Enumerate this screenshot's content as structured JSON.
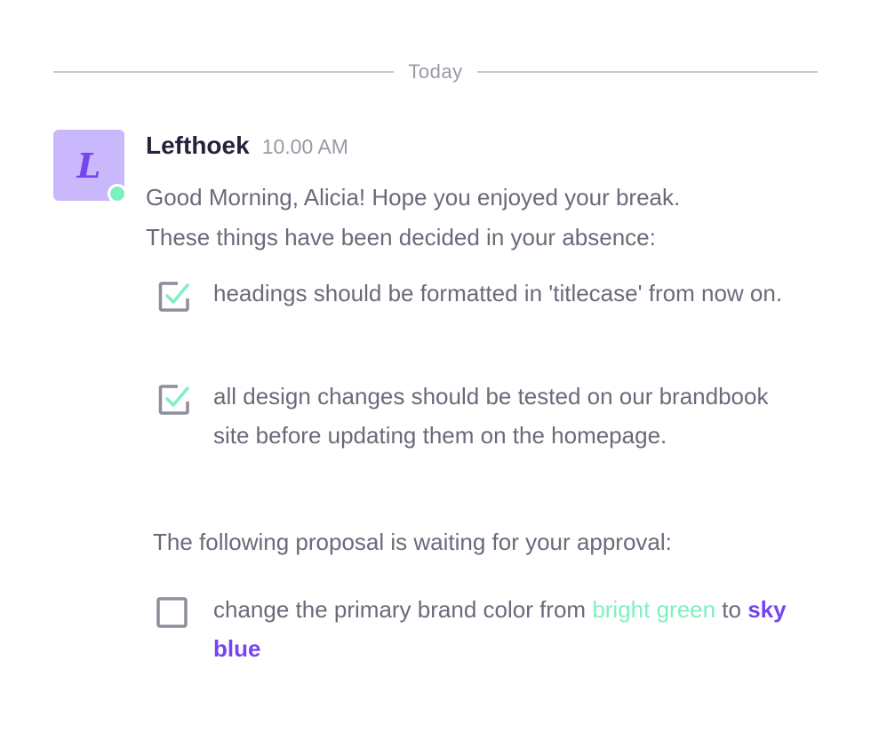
{
  "divider": {
    "label": "Today"
  },
  "message": {
    "avatar_letter": "L",
    "author": "Lefthoek",
    "time": "10.00 AM",
    "intro_line1": "Good Morning, Alicia! Hope you enjoyed your break.",
    "intro_line2": "These things have been decided in your absence:",
    "decided": [
      {
        "text": "headings should be formatted in 'titlecase' from now on.",
        "checked": true
      },
      {
        "text": "all design changes should be tested on our brandbook site before updating them on the homepage.",
        "checked": true
      }
    ],
    "approval_heading": "The following proposal is waiting for your approval:",
    "proposal": {
      "checked": false,
      "prefix": "change the primary brand color from ",
      "from_color": "bright green",
      "middle": " to ",
      "to_color": "sky blue"
    }
  },
  "colors": {
    "avatar_bg": "#c9b8fb",
    "accent_purple": "#7445f0",
    "accent_green": "#7ef0c0",
    "text": "#6b6a7a",
    "author": "#25233a"
  },
  "icons": {
    "checked": "checkbox-checked-icon",
    "unchecked": "checkbox-unchecked-icon",
    "presence": "online-status-dot"
  }
}
